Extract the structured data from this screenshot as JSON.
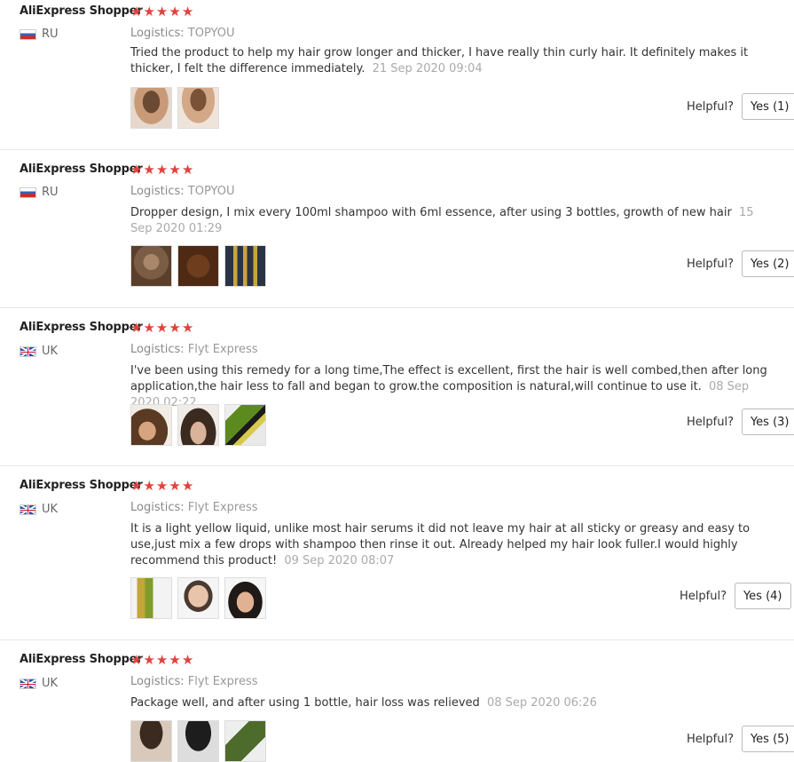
{
  "reviews": [
    {
      "user": "AliExpress Shopper",
      "rating": 5,
      "country": "RU",
      "flag": "ru",
      "logistics_label": "Logistics:",
      "logistics": "TOPYOU",
      "text": "Tried the product to help my hair grow longer and thicker, I have really thin curly hair. It definitely makes it thicker, I felt the difference immediately.",
      "date": "21 Sep 2020 09:04",
      "photos": [
        "hair-photo",
        "hair-photo"
      ],
      "helpful_label": "Helpful?",
      "yes_label": "Yes (1)"
    },
    {
      "user": "AliExpress Shopper",
      "rating": 5,
      "country": "RU",
      "flag": "ru",
      "logistics_label": "Logistics:",
      "logistics": "TOPYOU",
      "text": "Dropper design, I mix every 100ml shampoo with 6ml essence, after using 3 bottles, growth of new hair",
      "date": "15 Sep 2020 01:29",
      "photos": [
        "scalp-photo",
        "scalp-photo",
        "bottles-photo"
      ],
      "helpful_label": "Helpful?",
      "yes_label": "Yes (2)"
    },
    {
      "user": "AliExpress Shopper",
      "rating": 5,
      "country": "UK",
      "flag": "uk",
      "logistics_label": "Logistics:",
      "logistics": "Flyt Express",
      "text": "I've been using this remedy for a long time,The effect is excellent, first the hair is well combed,then after long application,the hair less to fall and began to grow.the composition is natural,will continue to use it.",
      "date": "08 Sep 2020 02:22",
      "photos": [
        "head-photo",
        "head-photo",
        "bottle-photo"
      ],
      "helpful_label": "Helpful?",
      "yes_label": "Yes (3)"
    },
    {
      "user": "AliExpress Shopper",
      "rating": 5,
      "country": "UK",
      "flag": "uk",
      "logistics_label": "Logistics:",
      "logistics": "Flyt Express",
      "text": "It is a light yellow liquid, unlike most hair serums it did not leave my hair at all sticky or greasy and easy to use,just mix a few drops with shampoo then rinse it out. Already helped my hair look fuller.I would highly recommend this product!",
      "date": "09 Sep 2020 08:07",
      "photos": [
        "bottle-photo",
        "head-photo",
        "face-photo"
      ],
      "helpful_label": "Helpful?",
      "yes_label": "Yes (4)"
    },
    {
      "user": "AliExpress Shopper",
      "rating": 5,
      "country": "UK",
      "flag": "uk",
      "logistics_label": "Logistics:",
      "logistics": "Flyt Express",
      "text": "Package well, and after using 1 bottle, hair loss was relieved",
      "date": "08 Sep 2020 06:26",
      "photos": [
        "head-photo",
        "head-photo",
        "box-photo"
      ],
      "helpful_label": "Helpful?",
      "yes_label": "Yes (5)"
    }
  ],
  "colors": {
    "star": "#e0433e",
    "date": "#aaaaaa",
    "logistics": "#999999"
  },
  "star_glyph": "★"
}
